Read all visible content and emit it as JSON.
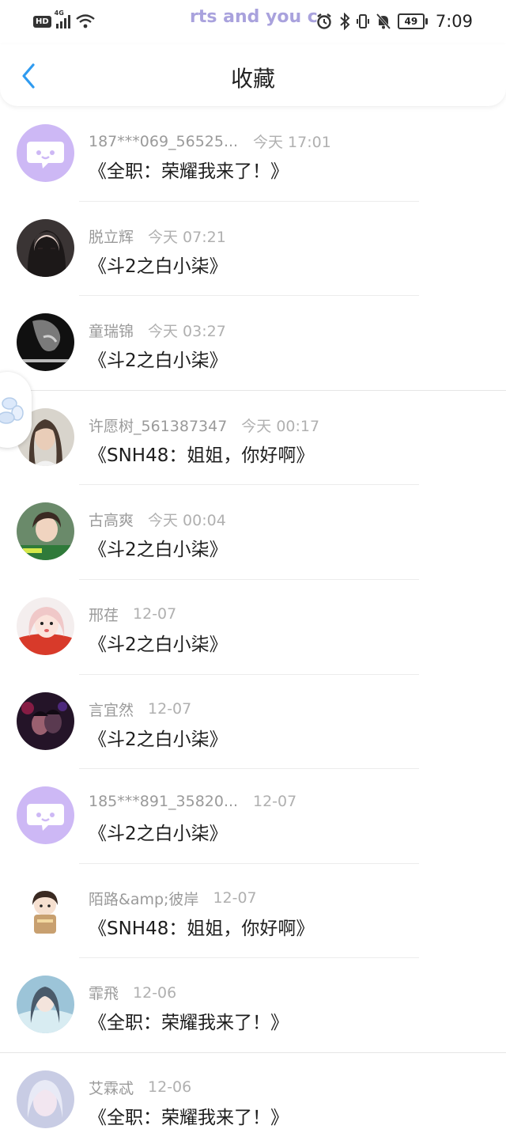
{
  "status_bar": {
    "network_badge": "HD",
    "signal_label": "4G",
    "marquee_text": "rts and you ca",
    "battery_level": "49",
    "time": "7:09"
  },
  "header": {
    "title": "收藏",
    "back_icon": "chevron-left-icon",
    "accent_color": "#2f9bf0"
  },
  "favorites": [
    {
      "name": "187***069_56525...",
      "time": "今天 17:01",
      "title": "《全职：荣耀我来了！》",
      "avatar": "default-chat-avatar"
    },
    {
      "name": "脱立辉",
      "time": "今天 07:21",
      "title": "《斗2之白小柒》",
      "avatar": "photo-avatar"
    },
    {
      "name": "童瑞锦",
      "time": "今天 03:27",
      "title": "《斗2之白小柒》",
      "avatar": "photo-avatar"
    },
    {
      "name": "许愿树_561387347",
      "time": "今天 00:17",
      "title": "《SNH48：姐姐，你好啊》",
      "avatar": "photo-avatar"
    },
    {
      "name": "古高爽",
      "time": "今天 00:04",
      "title": "《斗2之白小柒》",
      "avatar": "photo-avatar"
    },
    {
      "name": "邢荏",
      "time": "12-07",
      "title": "《斗2之白小柒》",
      "avatar": "photo-avatar"
    },
    {
      "name": "言宜然",
      "time": "12-07",
      "title": "《斗2之白小柒》",
      "avatar": "photo-avatar"
    },
    {
      "name": "185***891_35820...",
      "time": "12-07",
      "title": "《斗2之白小柒》",
      "avatar": "default-chat-avatar"
    },
    {
      "name": "陌路&amp;彼岸",
      "time": "12-07",
      "title": "《SNH48：姐姐，你好啊》",
      "avatar": "photo-avatar"
    },
    {
      "name": "霏飛",
      "time": "12-06",
      "title": "《全职：荣耀我来了！》",
      "avatar": "photo-avatar"
    },
    {
      "name": "艾霖忒",
      "time": "12-06",
      "title": "《全职：荣耀我来了！》",
      "avatar": "photo-avatar"
    }
  ]
}
